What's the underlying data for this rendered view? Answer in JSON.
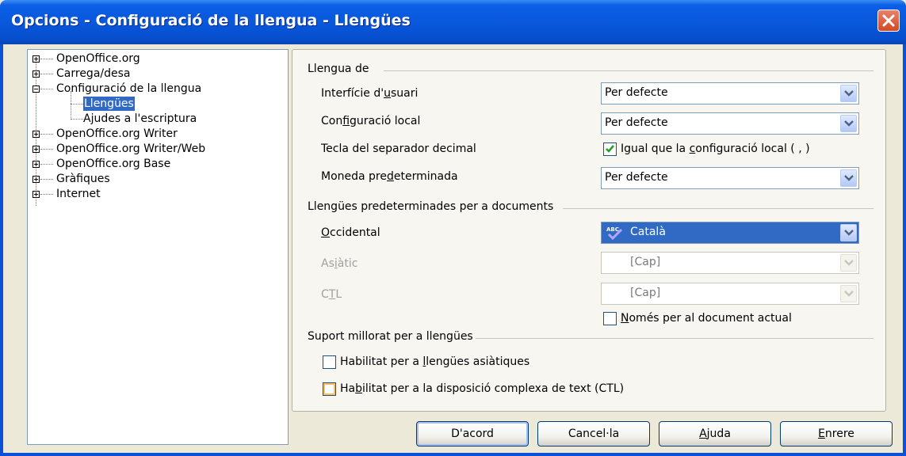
{
  "window": {
    "title": "Opcions - Configuració de la llengua - Llengües"
  },
  "tree": {
    "items": [
      {
        "label": "OpenOffice.org",
        "expander": "plus"
      },
      {
        "label": "Carrega/desa",
        "expander": "plus"
      },
      {
        "label": "Configuració de la llengua",
        "expander": "minus"
      },
      {
        "label": "Llengües",
        "selected": true
      },
      {
        "label": "Ajudes a l'escriptura"
      },
      {
        "label": "OpenOffice.org Writer",
        "expander": "plus"
      },
      {
        "label": "OpenOffice.org Writer/Web",
        "expander": "plus"
      },
      {
        "label": "OpenOffice.org Base",
        "expander": "plus"
      },
      {
        "label": "Gràfiques",
        "expander": "plus"
      },
      {
        "label": "Internet",
        "expander": "plus"
      }
    ]
  },
  "language_of": {
    "section_label": "Llengua de",
    "ui_label_pre": "Interfície d'",
    "ui_label_u": "u",
    "ui_label_post": "suari",
    "ui_value": "Per defecte",
    "locale_label_pre": "Con",
    "locale_label_u": "f",
    "locale_label_post": "iguració local",
    "locale_value": "Per defecte",
    "decimal_label": "Tecla del separador decimal",
    "decimal_check_pre": "Igual que la ",
    "decimal_check_u": "c",
    "decimal_check_post": "onfiguració local ( , )",
    "decimal_checked": true,
    "currency_label_pre": "Moneda pre",
    "currency_label_u": "d",
    "currency_label_post": "eterminada",
    "currency_value": "Per defecte"
  },
  "default_languages": {
    "section_label": "Llengües predeterminades per a documents",
    "western_label_u": "O",
    "western_label_post": "ccidental",
    "western_value": "Català",
    "asian_label_pre": "As",
    "asian_label_u": "i",
    "asian_label_post": "àtic",
    "asian_value": "[Cap]",
    "ctl_label_pre": "C",
    "ctl_label_u": "T",
    "ctl_label_post": "L",
    "ctl_value": "[Cap]",
    "only_current_u": "N",
    "only_current_post": "omés per al document actual",
    "only_current_checked": false
  },
  "enhanced": {
    "section_label": "Suport millorat per a llengües",
    "asian_pre": "Habilitat per a ",
    "asian_u": "l",
    "asian_post": "lengües asiàtiques",
    "asian_checked": false,
    "ctl_pre": "Ha",
    "ctl_u": "b",
    "ctl_post": "ilitat per a la disposició complexa de text (CTL)",
    "ctl_checked": false
  },
  "buttons": {
    "ok": "D'acord",
    "cancel": "Cancel·la",
    "help_u": "A",
    "help_post": "juda",
    "back_u": "E",
    "back_post": "nrere"
  }
}
